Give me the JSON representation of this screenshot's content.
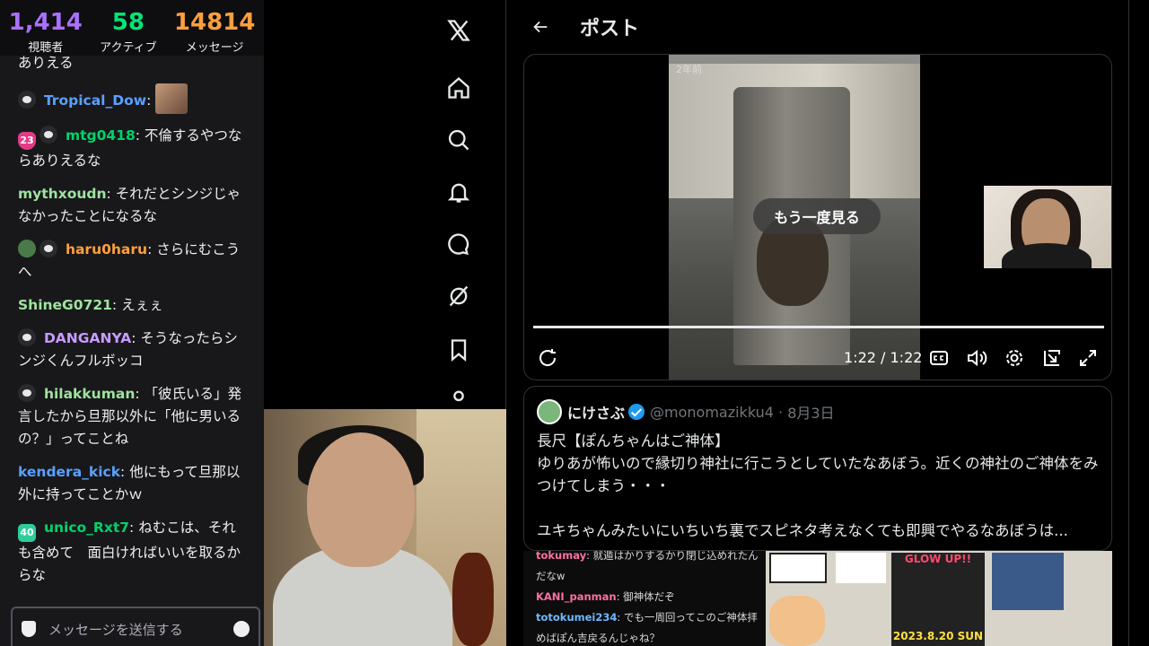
{
  "stats": {
    "viewers": {
      "value": "1,414",
      "label": "視聴者"
    },
    "active": {
      "value": "58",
      "label": "アクティブ"
    },
    "messages": {
      "value": "14814",
      "label": "メッセージ"
    }
  },
  "chat": {
    "partial_top": "ありえる",
    "messages": [
      {
        "user": "Tropical_Dow",
        "color": "#5aa0ff",
        "text": ""
      },
      {
        "user": "mtg0418",
        "color": "#00d26a",
        "text": "不倫するやつならありえるな",
        "badge_num": "23"
      },
      {
        "user": "mythxoudn",
        "color": "#9fe39f",
        "text": "それだとシンジじゃなかったことになるな"
      },
      {
        "user": "haru0haru",
        "color": "#ff9f3d",
        "text": "さらにむこうへ"
      },
      {
        "user": "ShineG0721",
        "color": "#9fe39f",
        "text": "えぇぇ"
      },
      {
        "user": "DANGANYA",
        "color": "#c89bff",
        "text": "そうなったらシンジくんフルボッコ"
      },
      {
        "user": "hilakkuman",
        "color": "#9fe39f",
        "text": "「彼氏いる」発言したから旦那以外に「他に男いるの？」ってことね"
      },
      {
        "user": "kendera_kick",
        "color": "#5aa0ff",
        "text": "他にもって旦那以外に持ってことかｗ"
      },
      {
        "user": "unico_Rxt7",
        "color": "#00d26a",
        "text": "ねむこは、それも含めて　面白ければいいを取るからな",
        "badge_num": "40"
      }
    ],
    "input_placeholder": "メッセージを送信する"
  },
  "post": {
    "header_title": "ポスト",
    "video": {
      "timestamp_label": "2年前",
      "replay_label": "もう一度見る",
      "time": "1:22 / 1:22",
      "progress": 1.0
    },
    "quote": {
      "name": "にけさぶ",
      "handle": "@monomazikku4",
      "date": "8月3日",
      "text": "長尺【ぽんちゃんはご神体】\nゆりあが怖いので縁切り神社に行こうとしていたなあぼう。近くの神社のご神体をみつけてしまう・・・\n\nユキちゃんみたいにいちいち裏でスピネタ考えなくても即興でやるなあぼうは..."
    },
    "embed": {
      "lines": [
        {
          "user": "tokumay",
          "text": "就遁はかりするかり閉じ込めれたんだなw"
        },
        {
          "user": "KANI_panman",
          "text": "御神体だぞ"
        },
        {
          "user": "totokumei234",
          "text": "でも一周回ってこのご神体拝めばぽん吉戻るんじゃね？"
        }
      ],
      "poster_text": "GLOW UP!!",
      "poster_date": "2023.8.20 SUN"
    }
  }
}
